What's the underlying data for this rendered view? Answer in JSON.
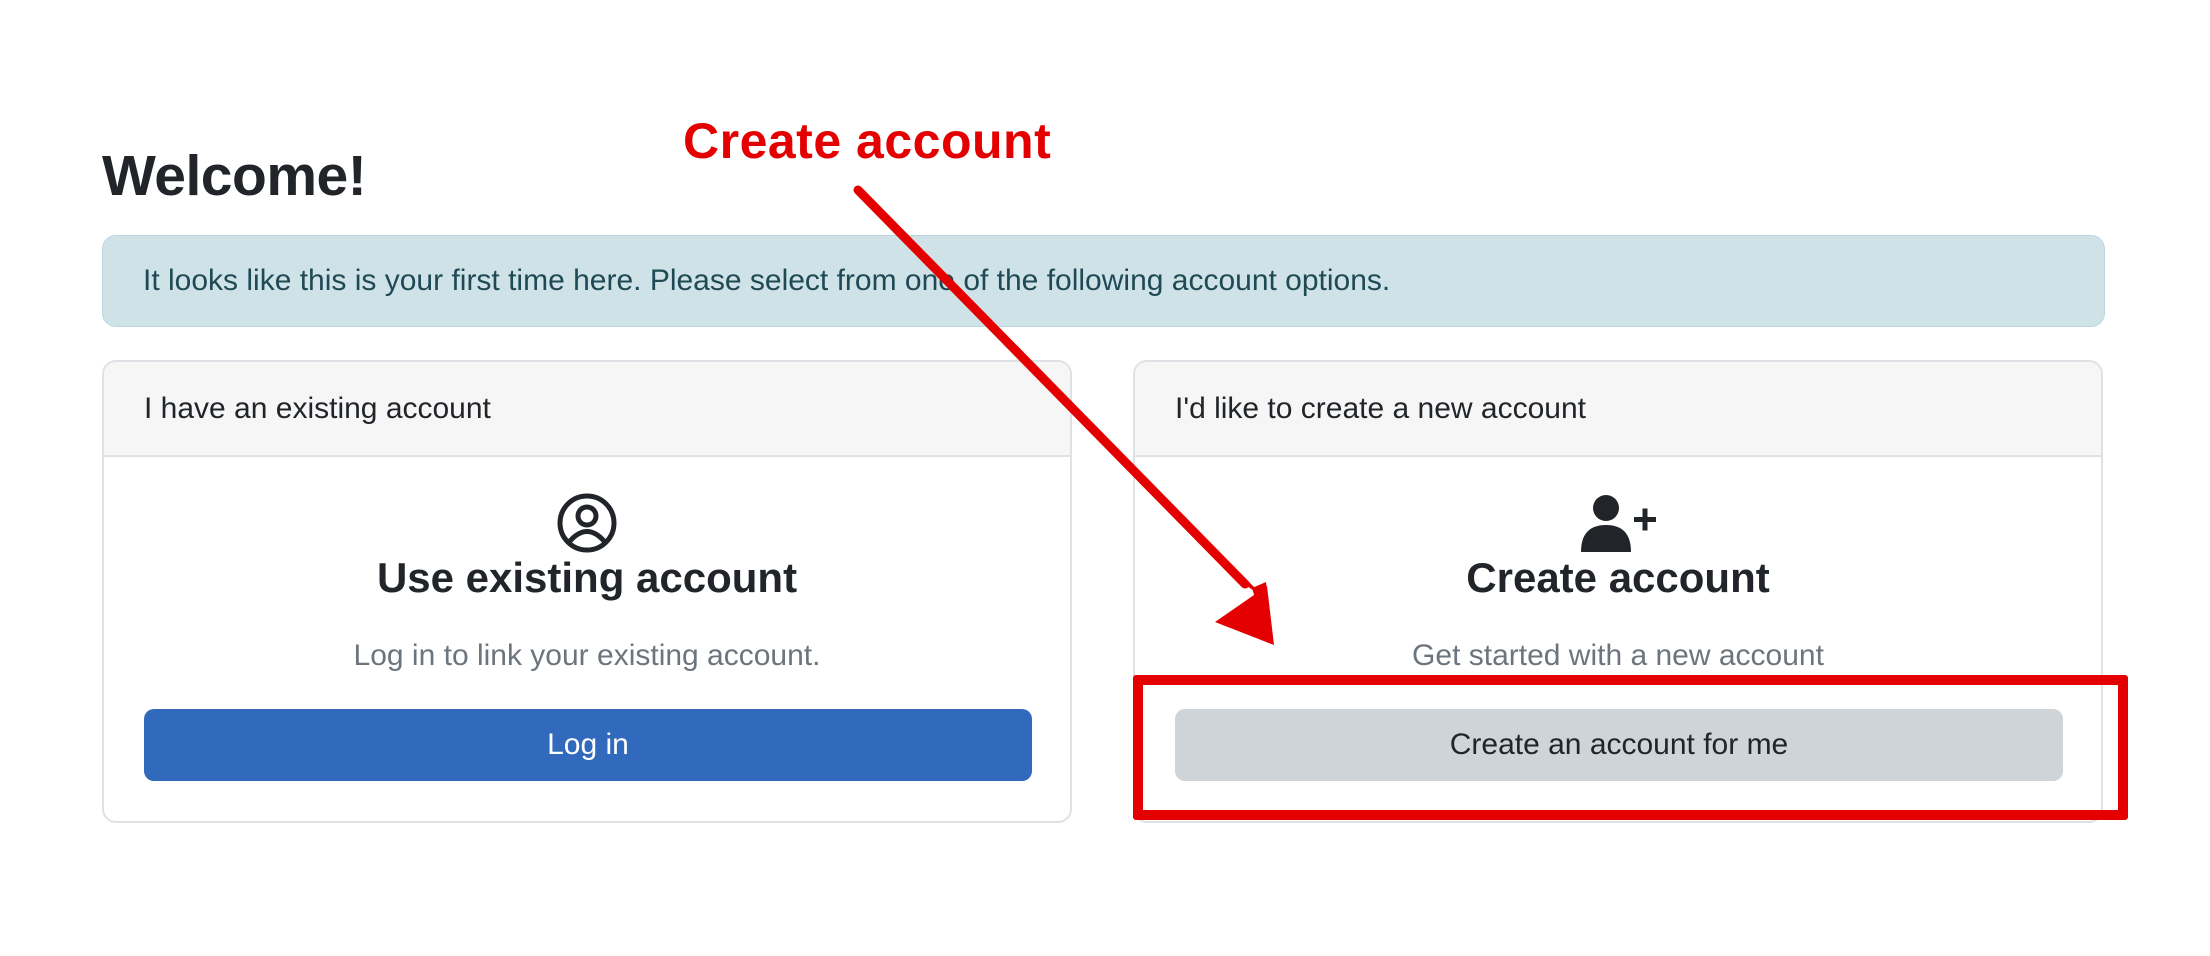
{
  "page": {
    "title": "Welcome!",
    "alert": "It looks like this is your first time here. Please select from one of the following account options."
  },
  "existing_card": {
    "header": "I have an existing account",
    "icon": "user-circle-icon",
    "title": "Use existing account",
    "text": "Log in to link your existing account.",
    "button": "Log in"
  },
  "create_card": {
    "header": "I'd like to create a new account",
    "icon": "user-plus-icon",
    "title": "Create account",
    "text": "Get started with a new account",
    "button": "Create an account for me"
  },
  "annotation": {
    "label": "Create account",
    "color": "#e40000"
  },
  "colors": {
    "primary": "#316abd",
    "secondary": "#cfd4d8",
    "alert_bg": "#cfe2e7"
  }
}
